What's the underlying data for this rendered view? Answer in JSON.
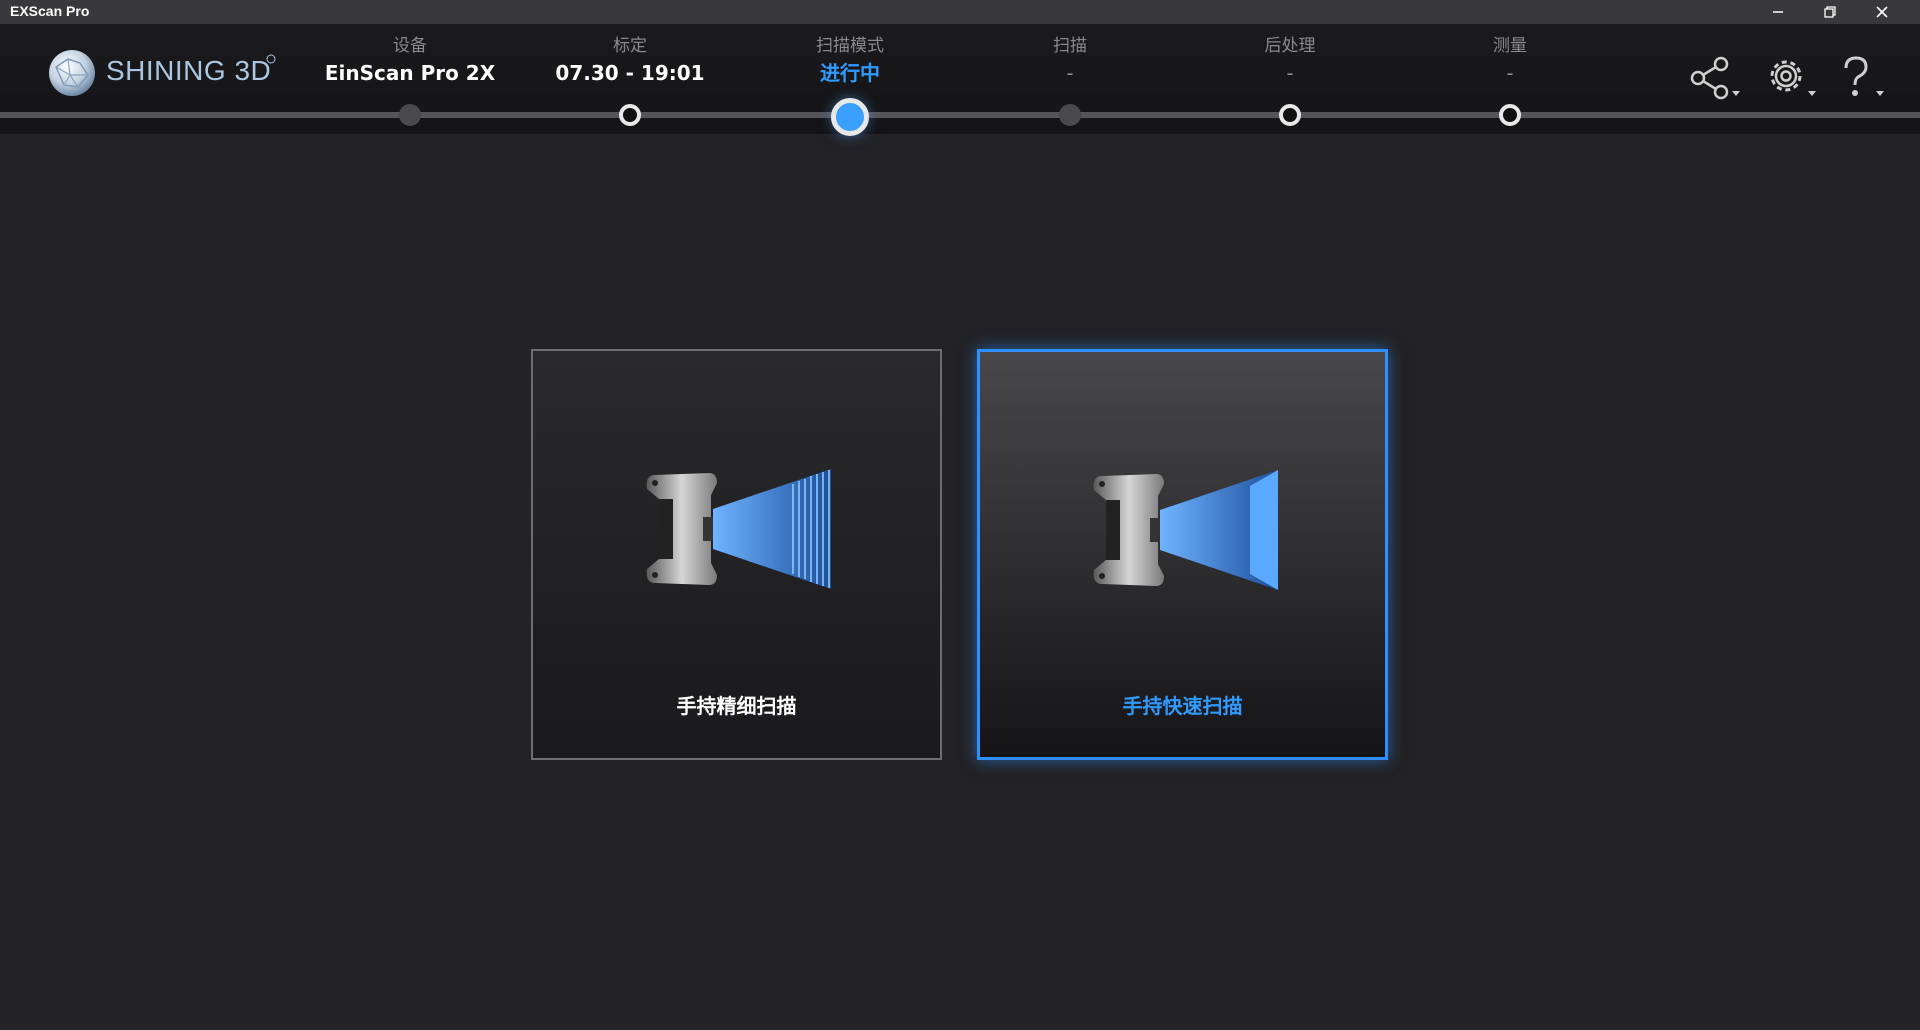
{
  "app": {
    "title": "EXScan Pro"
  },
  "logo": {
    "text": "SHINING 3D"
  },
  "steps": [
    {
      "label": "设备",
      "value": "EinScan Pro 2X",
      "state": "done"
    },
    {
      "label": "标定",
      "value": "07.30 - 19:01",
      "state": "done"
    },
    {
      "label": "扫描模式",
      "value": "进行中",
      "state": "current"
    },
    {
      "label": "扫描",
      "value": "-",
      "state": "pending"
    },
    {
      "label": "后处理",
      "value": "-",
      "state": "pending"
    },
    {
      "label": "测量",
      "value": "-",
      "state": "pending"
    }
  ],
  "toolbar": {
    "icons": [
      "share-icon",
      "settings-icon",
      "help-icon"
    ]
  },
  "modes": [
    {
      "label": "手持精细扫描",
      "selected": false
    },
    {
      "label": "手持快速扫描",
      "selected": true
    }
  ],
  "colors": {
    "accent": "#2f9bff",
    "background": "#232326",
    "header": "#1b1b1d"
  }
}
